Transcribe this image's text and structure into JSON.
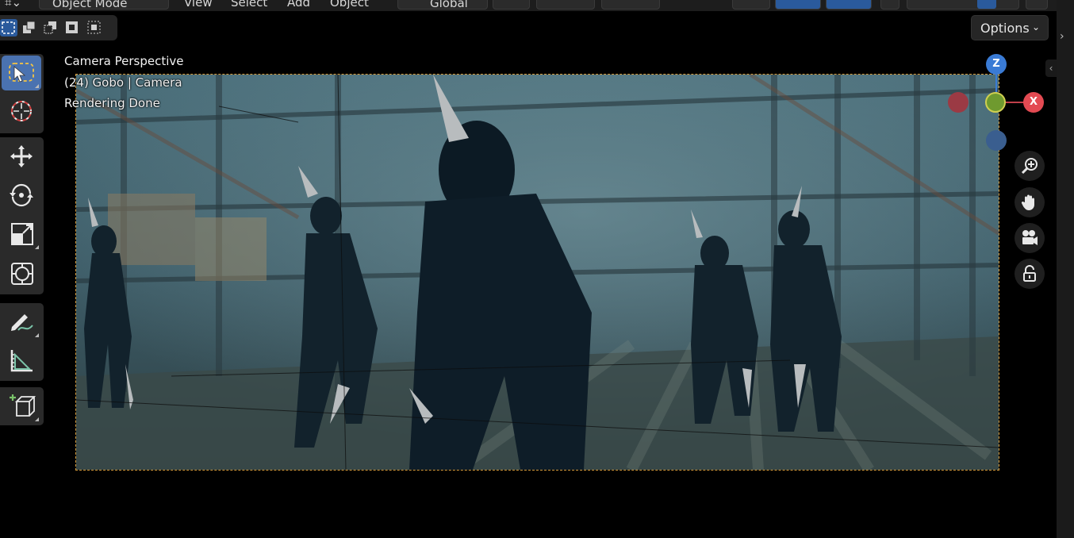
{
  "header": {
    "mode_label": "Object Mode",
    "menus": [
      "View",
      "Select",
      "Add",
      "Object"
    ],
    "orientation_label": "Global"
  },
  "tool_settings": {
    "options_label": "Options"
  },
  "viewport": {
    "view_name": "Camera Perspective",
    "object_info": "(24) Gobo | Camera",
    "status": "Rendering Done"
  },
  "gizmo": {
    "axis_z": "Z",
    "axis_x": "X",
    "colors": {
      "x": "#e34a52",
      "y": "#6f9a2f",
      "z": "#3a7bd5",
      "neg_x": "#9b3a44",
      "neg_z": "#3a5e8f"
    }
  },
  "toolbar": {
    "tools": [
      "select-box",
      "cursor",
      "move",
      "rotate",
      "scale",
      "transform",
      "annotate",
      "measure",
      "add-cube"
    ],
    "active_tool": "select-box"
  },
  "navigation": [
    "zoom-icon",
    "pan-hand-icon",
    "camera-view-icon",
    "lock-camera-icon"
  ]
}
